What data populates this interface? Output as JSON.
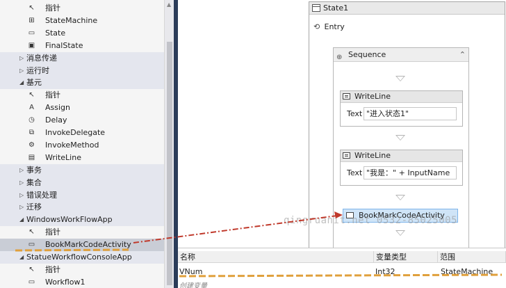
{
  "toolbox": {
    "rows": [
      {
        "kind": "item",
        "label": "指针",
        "icon": "pointer-icon"
      },
      {
        "kind": "item",
        "label": "StateMachine",
        "icon": "state-machine-icon"
      },
      {
        "kind": "item",
        "label": "State",
        "icon": "state-icon"
      },
      {
        "kind": "item",
        "label": "FinalState",
        "icon": "final-state-icon"
      },
      {
        "kind": "category",
        "label": "消息传递",
        "expanded": false
      },
      {
        "kind": "category",
        "label": "运行时",
        "expanded": false
      },
      {
        "kind": "category",
        "label": "基元",
        "expanded": true
      },
      {
        "kind": "item",
        "label": "指针",
        "icon": "pointer-icon"
      },
      {
        "kind": "item",
        "label": "Assign",
        "icon": "assign-icon"
      },
      {
        "kind": "item",
        "label": "Delay",
        "icon": "clock-icon"
      },
      {
        "kind": "item",
        "label": "InvokeDelegate",
        "icon": "invoke-delegate-icon"
      },
      {
        "kind": "item",
        "label": "InvokeMethod",
        "icon": "invoke-method-icon"
      },
      {
        "kind": "item",
        "label": "WriteLine",
        "icon": "writeline-icon"
      },
      {
        "kind": "category",
        "label": "事务",
        "expanded": false
      },
      {
        "kind": "category",
        "label": "集合",
        "expanded": false
      },
      {
        "kind": "category",
        "label": "错误处理",
        "expanded": false
      },
      {
        "kind": "category",
        "label": "迁移",
        "expanded": false
      },
      {
        "kind": "category",
        "label": "WindowsWorkFlowApp",
        "expanded": true
      },
      {
        "kind": "item",
        "label": "指针",
        "icon": "pointer-icon"
      },
      {
        "kind": "item",
        "label": "BookMarkCodeActivity",
        "icon": "activity-icon",
        "selected": true
      },
      {
        "kind": "category",
        "label": "StatueWorkflowConsoleApp",
        "expanded": true
      },
      {
        "kind": "item",
        "label": "指针",
        "icon": "pointer-icon"
      },
      {
        "kind": "item",
        "label": "Workflow1",
        "icon": "activity-icon"
      }
    ]
  },
  "designer": {
    "state_title": "State1",
    "entry_label": "Entry",
    "sequence_title": "Sequence",
    "writeline1": {
      "title": "WriteLine",
      "text_label": "Text",
      "text_value": "\"进入状态1\""
    },
    "writeline2": {
      "title": "WriteLine",
      "text_label": "Text",
      "text_value": "\"我是：\" + InputName"
    },
    "dropped_activity": "BookMarkCodeActivity"
  },
  "variables": {
    "headers": [
      "名称",
      "变量类型",
      "范围"
    ],
    "rows": [
      {
        "name": "VNum",
        "type": "Int32",
        "scope": "StateMachine"
      }
    ],
    "create_label": "创建变量"
  },
  "watermark": "qingruanit.net 0532-85025005",
  "colors": {
    "arrow": "#c0392b",
    "highlight_line": "#e0a03c",
    "selection": "#c9cdd6",
    "splitter": "#2b3c59"
  }
}
